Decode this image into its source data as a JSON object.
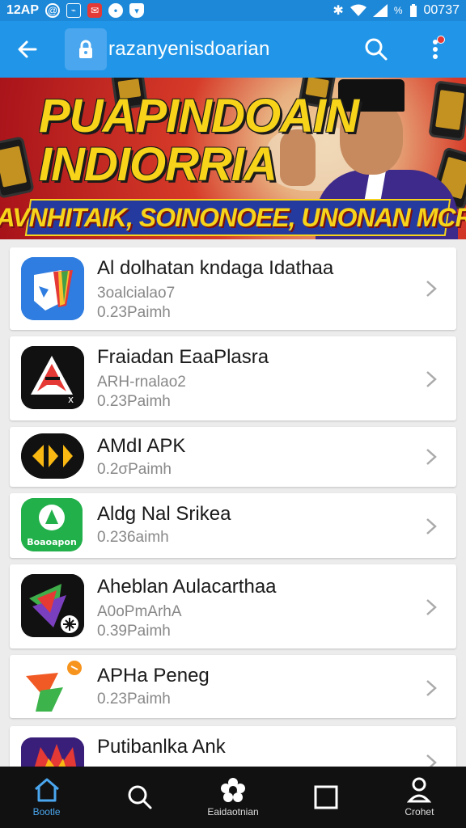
{
  "status_bar": {
    "time": "12AP",
    "battery": "%",
    "clock": "00737"
  },
  "app_bar": {
    "url_text": "razanyenisdoarian"
  },
  "banner": {
    "title_line1": "PUAPINDOAIN",
    "title_line2": "INDIORRIA",
    "strip_text": "CAVNHITAIK, SOINONOEE, UNONAN MCRIN"
  },
  "apps": [
    {
      "title": "Al dolhatan kndaga Idathaa",
      "line2": "3oalcialao7",
      "line3": "0.23Paimh",
      "icon": "shield-rainbow-icon"
    },
    {
      "title": "Fraiadan EaaPlasra",
      "line2": "ARH-rnalao2",
      "line3": "0.23Paimh",
      "icon": "red-a-logo-icon"
    },
    {
      "title": "AMdI APK",
      "line2": "0.2σPaimh",
      "icon": "yellow-m-logo-icon"
    },
    {
      "title": "Aldg Nal Srikea",
      "line2": "0.236aimh",
      "icon": "green-badge-icon",
      "icon_text": "Boaoapon"
    },
    {
      "title": "Aheblan Aulacarthaa",
      "line2": "A0oPmArhA",
      "line3": "0.39Paimh",
      "icon": "colorful-star-icon"
    },
    {
      "title": "APHa Peneg",
      "line2": "0.23Paimh",
      "icon": "orange-flag-icon"
    },
    {
      "title": "Putibanlka Ank",
      "line2": "",
      "icon": "purple-crown-icon"
    }
  ],
  "bottom_nav": [
    {
      "label": "Bootle",
      "icon": "home-icon"
    },
    {
      "label": "",
      "icon": "search-icon"
    },
    {
      "label": "Eaidaotnian",
      "icon": "flower-icon"
    },
    {
      "label": "",
      "icon": "square-icon"
    },
    {
      "label": "Crohet",
      "icon": "person-icon"
    }
  ],
  "colors": {
    "app_bar": "#2196e8",
    "status_bar": "#1e88d8",
    "nav_active": "#4aa6ee",
    "banner_title": "#f7d41a"
  }
}
